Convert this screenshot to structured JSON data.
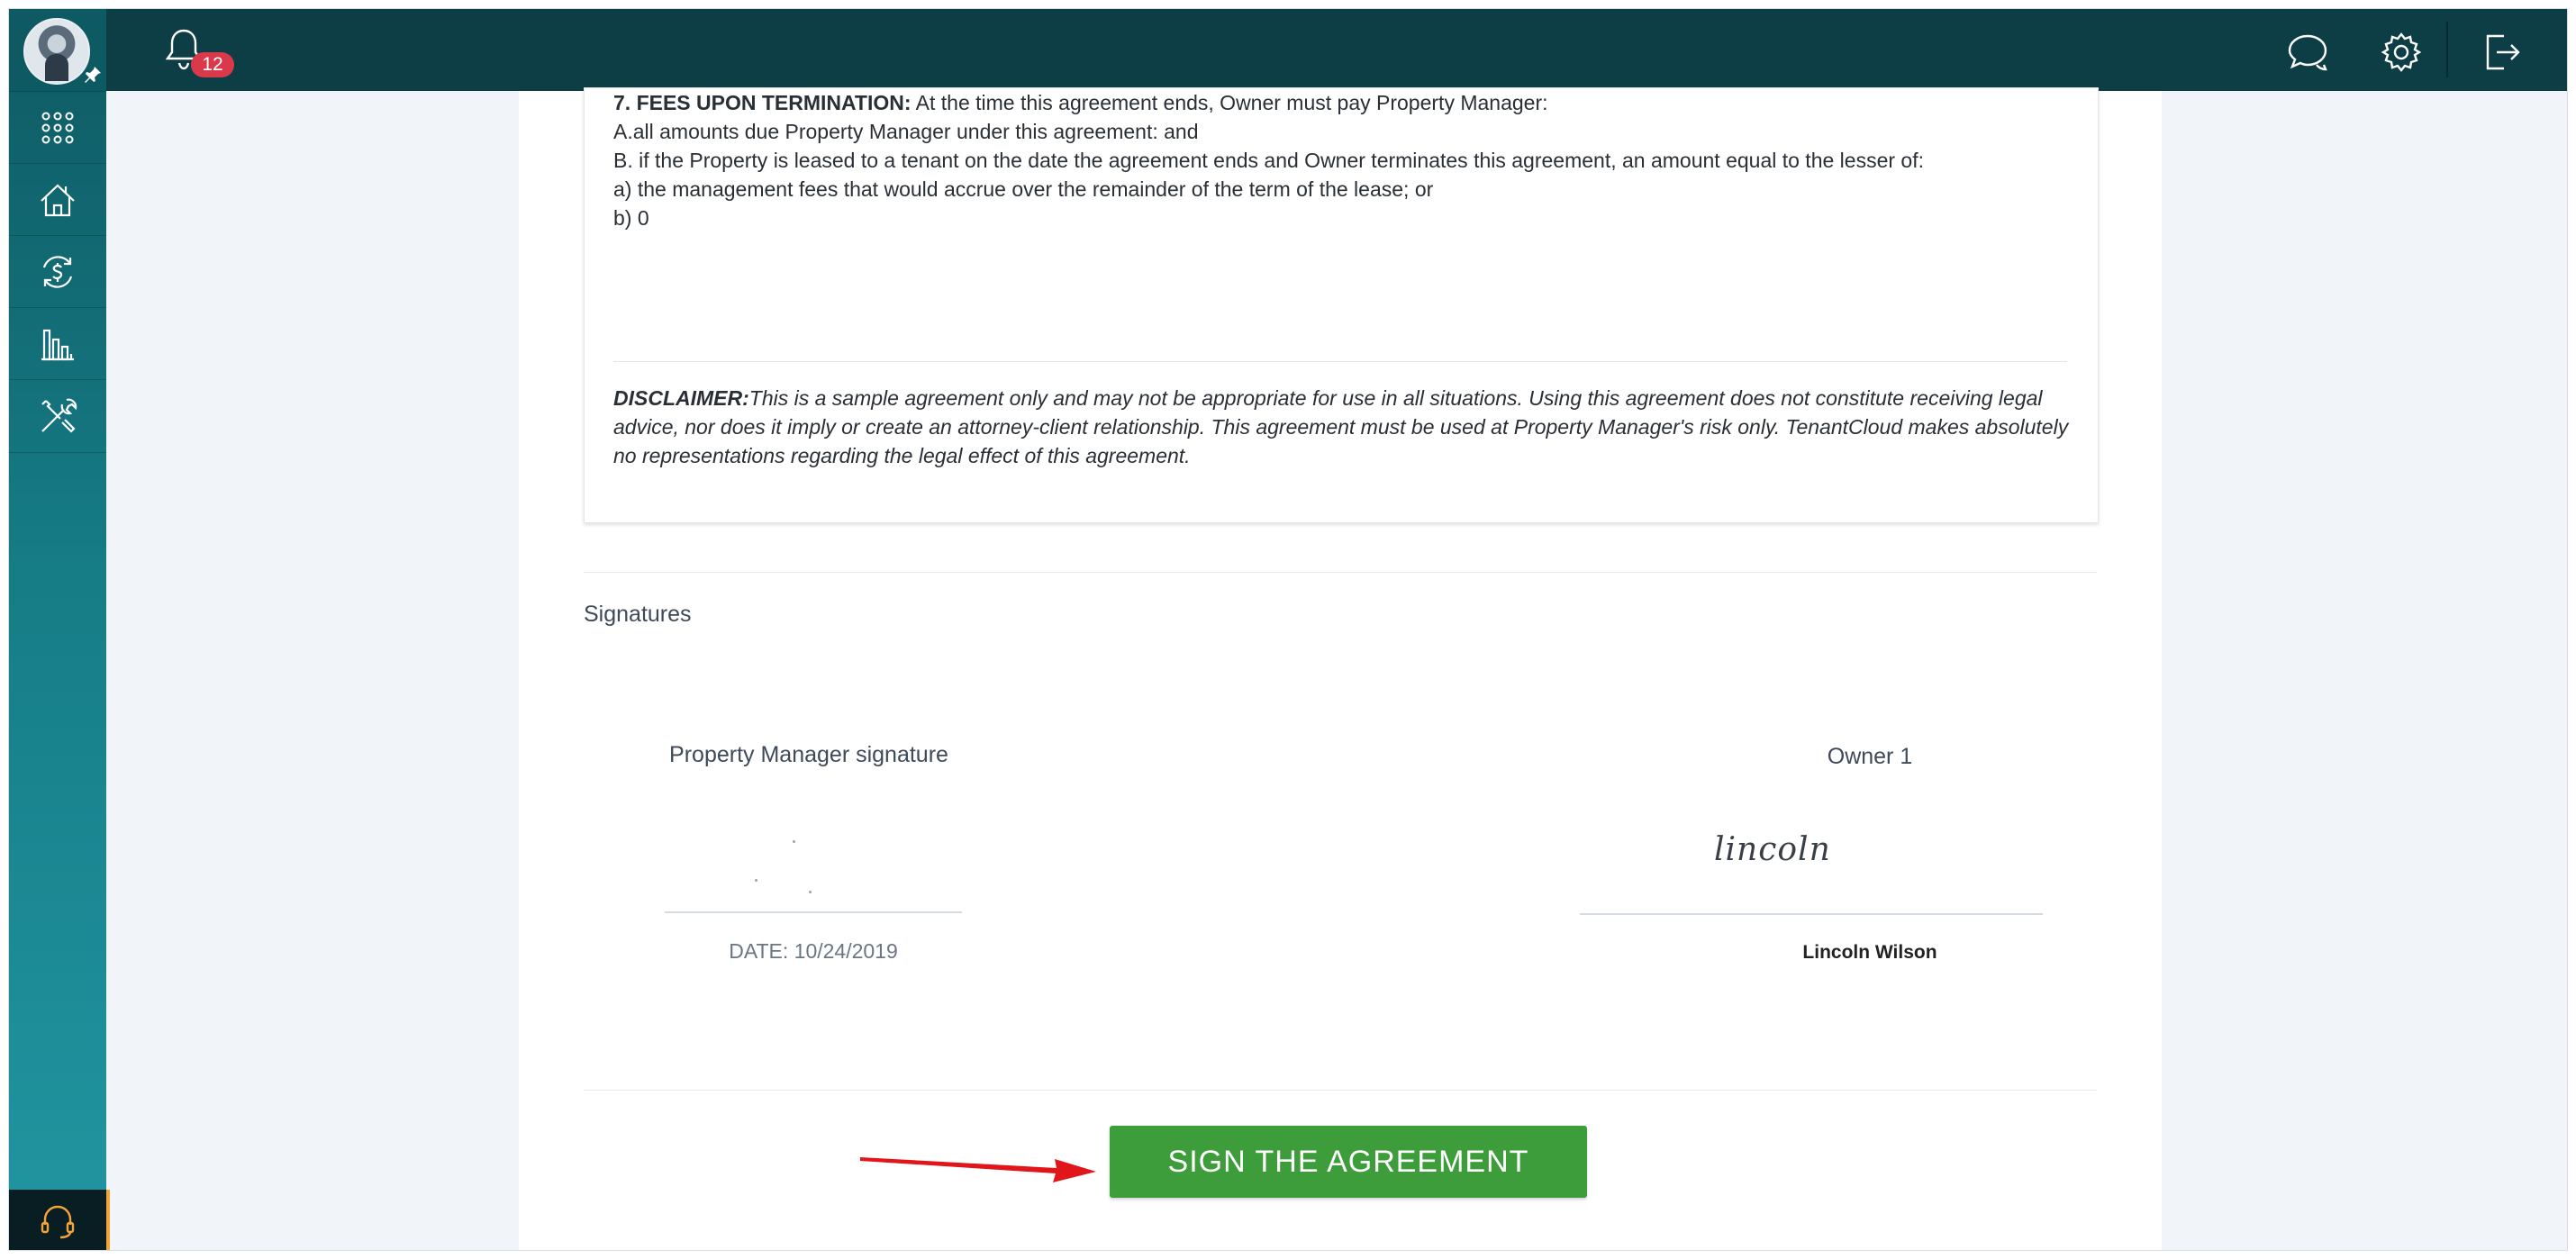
{
  "header": {
    "notifications_count": "12",
    "icons": [
      "bell-icon",
      "chat-icon",
      "gear-icon",
      "logout-icon"
    ]
  },
  "sidebar": {
    "items": [
      {
        "name": "apps-grid",
        "icon": "grid-icon"
      },
      {
        "name": "properties",
        "icon": "house-icon"
      },
      {
        "name": "accounting",
        "icon": "money-cycle-icon"
      },
      {
        "name": "reports",
        "icon": "bar-chart-icon"
      },
      {
        "name": "maintenance",
        "icon": "tools-icon"
      }
    ],
    "support_icon": "headset-icon"
  },
  "agreement": {
    "fees_heading": "7. FEES UPON TERMINATION:",
    "fees_intro": " At the time this agreement ends, Owner must pay Property Manager:",
    "fees_a": "A.all amounts due Property Manager under this agreement: and",
    "fees_b": "B. if the Property is leased to a tenant on the date the agreement ends and Owner terminates this agreement, an amount equal to the lesser of:",
    "fees_b_a": "a) the management fees that would accrue over the remainder of the term of the lease; or",
    "fees_b_b": "b)  0",
    "disclaimer_label": "DISCLAIMER:",
    "disclaimer_text": "This is a sample agreement only and may not be appropriate for use in all situations. Using this agreement does not constitute receiving legal advice, nor does it imply or create an attorney-client relationship. This agreement must be used at Property Manager's risk only. TenantCloud makes absolutely no representations regarding the legal effect of this agreement."
  },
  "signatures": {
    "title": "Signatures",
    "manager_label": "Property Manager signature",
    "manager_date": "DATE: 10/24/2019",
    "owner_label": "Owner 1",
    "owner_signature": "lincoln",
    "owner_name": "Lincoln Wilson"
  },
  "actions": {
    "sign_button": "SIGN THE AGREEMENT"
  },
  "colors": {
    "header_bg": "#0d3e45",
    "sidebar_bg": "#167c86",
    "sign_button_bg": "#3e9d3b",
    "badge_bg": "#d9394b",
    "arrow": "#e0161b"
  }
}
